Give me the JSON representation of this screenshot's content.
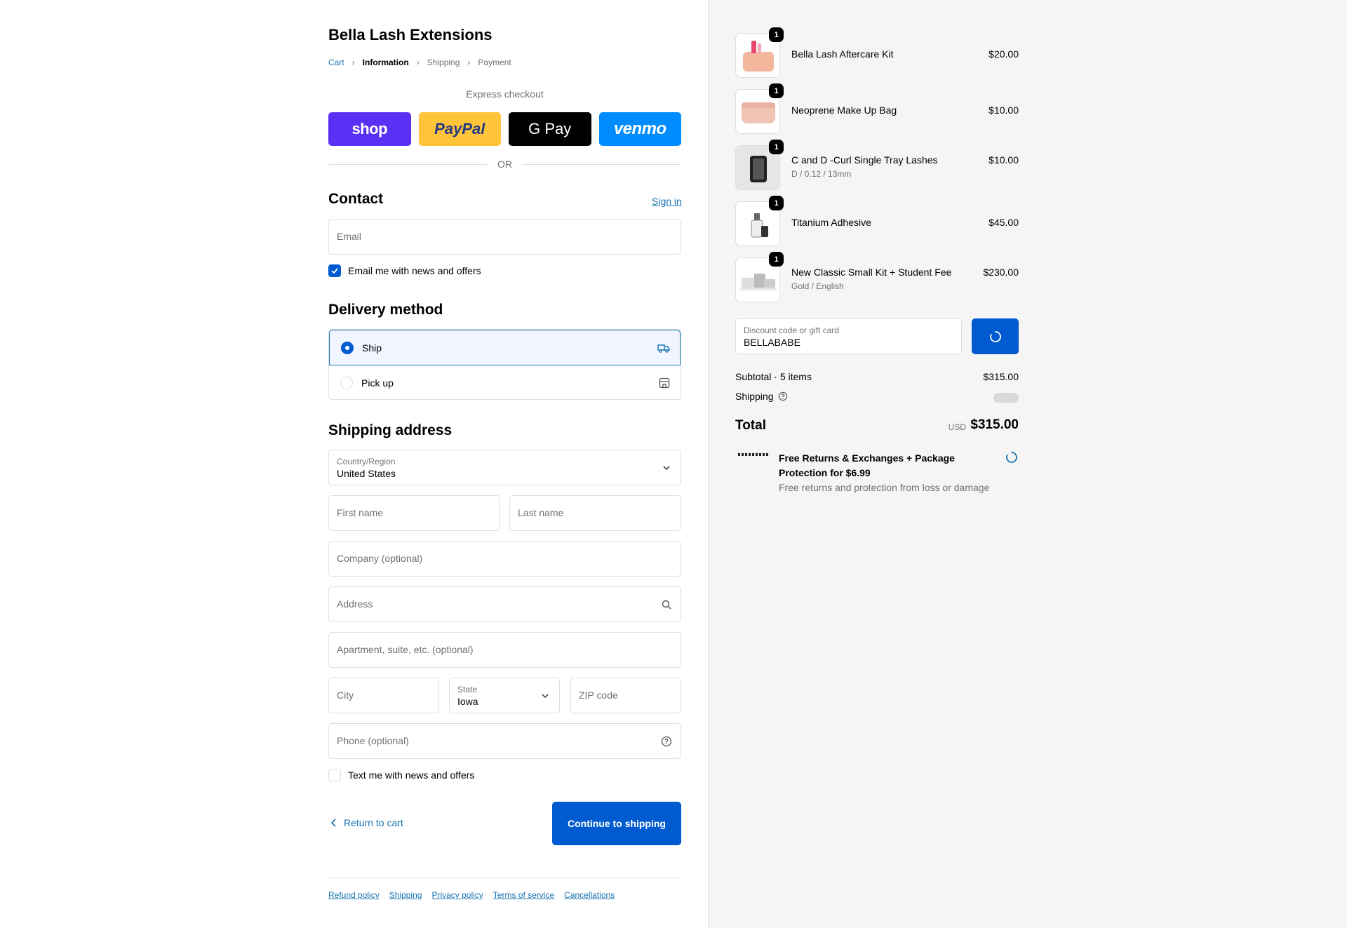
{
  "store": {
    "title": "Bella Lash Extensions"
  },
  "breadcrumbs": [
    "Cart",
    "Information",
    "Shipping",
    "Payment"
  ],
  "express": {
    "label": "Express checkout",
    "buttons": [
      "shop",
      "PayPal",
      "G Pay",
      "venmo"
    ],
    "or": "OR"
  },
  "contact": {
    "heading": "Contact",
    "sign_in": "Sign in",
    "email_placeholder": "Email",
    "news_label": "Email me with news and offers",
    "news_checked": true
  },
  "delivery": {
    "heading": "Delivery method",
    "options": [
      {
        "label": "Ship",
        "selected": true,
        "icon": "truck-icon"
      },
      {
        "label": "Pick up",
        "selected": false,
        "icon": "store-icon"
      }
    ]
  },
  "shipping": {
    "heading": "Shipping address",
    "country_label": "Country/Region",
    "country_value": "United States",
    "first_name": "First name",
    "last_name": "Last name",
    "company": "Company (optional)",
    "address": "Address",
    "apartment": "Apartment, suite, etc. (optional)",
    "city": "City",
    "state_label": "State",
    "state_value": "Iowa",
    "zip": "ZIP code",
    "phone": "Phone (optional)",
    "text_label": "Text me with news and offers",
    "text_checked": false
  },
  "actions": {
    "return": "Return to cart",
    "continue": "Continue to shipping"
  },
  "policies": [
    "Refund policy",
    "Shipping",
    "Privacy policy",
    "Terms of service",
    "Cancellations"
  ],
  "order": {
    "items": [
      {
        "name": "Bella Lash Aftercare Kit",
        "variant": "",
        "price": "$20.00",
        "qty": "1"
      },
      {
        "name": "Neoprene Make Up Bag",
        "variant": "",
        "price": "$10.00",
        "qty": "1"
      },
      {
        "name": "C and D -Curl Single Tray Lashes",
        "variant": "D / 0.12 / 13mm",
        "price": "$10.00",
        "qty": "1"
      },
      {
        "name": "Titanium Adhesive",
        "variant": "",
        "price": "$45.00",
        "qty": "1"
      },
      {
        "name": "New Classic Small Kit + Student Fee",
        "variant": "Gold / English",
        "price": "$230.00",
        "qty": "1"
      }
    ],
    "discount_label": "Discount code or gift card",
    "discount_value": "BELLABABE",
    "subtotal_label": "Subtotal · 5 items",
    "subtotal_value": "$315.00",
    "shipping_label": "Shipping",
    "total_label": "Total",
    "total_currency": "USD",
    "total_value": "$315.00"
  },
  "protection": {
    "title": "Free Returns & Exchanges + Package Protection for $6.99",
    "desc": "Free returns and protection from loss or damage"
  },
  "colors": {
    "accent": "#005bd1",
    "link": "#1773b0",
    "shop": "#5a31f4",
    "paypal": "#ffc439",
    "venmo": "#008cff"
  }
}
